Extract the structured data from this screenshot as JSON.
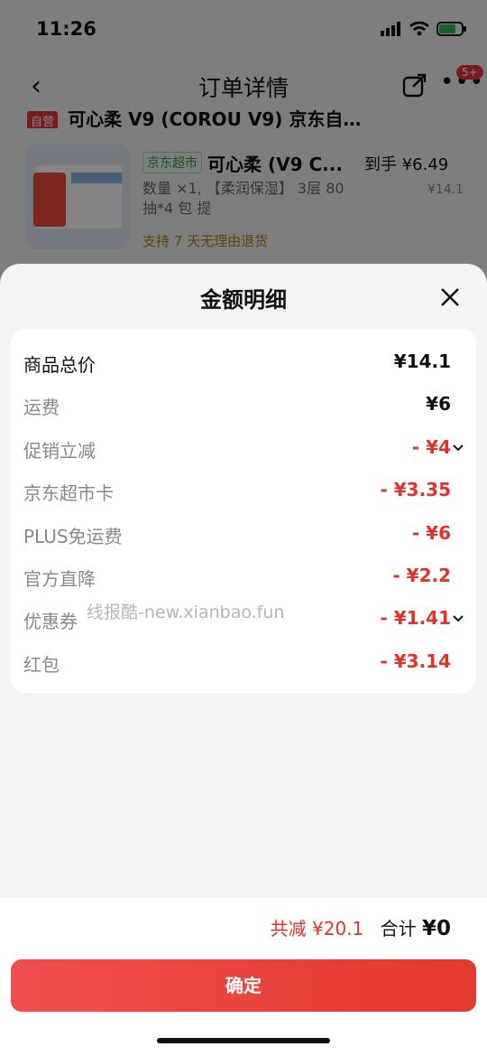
{
  "status": {
    "time": "11:26"
  },
  "nav": {
    "title": "订单详情",
    "badge": "5+"
  },
  "shop": {
    "tag": "自营",
    "name": "可心柔 V9 (COROU V9) 京东自…"
  },
  "product": {
    "channel": "京东超市",
    "name": "可心柔 (V9 C...",
    "price": "到手 ¥6.49",
    "spec": "数量 ×1, 【柔润保湿】 3层 80 抽*4 包 提",
    "orig_price": "¥14.1",
    "return_policy": "支持 7 天无理由退货"
  },
  "sheet": {
    "title": "金额明细",
    "rows": [
      {
        "label": "商品总价",
        "value": "¥14.1"
      },
      {
        "label": "运费",
        "value": "¥6"
      },
      {
        "label": "促销立减",
        "value": "- ¥4"
      },
      {
        "label": "京东超市卡",
        "value": "- ¥3.35"
      },
      {
        "label": "PLUS免运费",
        "value": "- ¥6"
      },
      {
        "label": "官方直降",
        "value": "- ¥2.2"
      },
      {
        "label": "优惠券",
        "value": "- ¥1.41"
      },
      {
        "label": "红包",
        "value": "- ¥3.14"
      }
    ],
    "watermark": "线报酷-new.xianbao.fun"
  },
  "footer": {
    "discount": "共减 ¥20.1",
    "total_label": "合计",
    "total_value": "¥0",
    "confirm": "确定"
  },
  "colors": {
    "accent_red": "#e0322b",
    "button_red": "#e4392e"
  }
}
